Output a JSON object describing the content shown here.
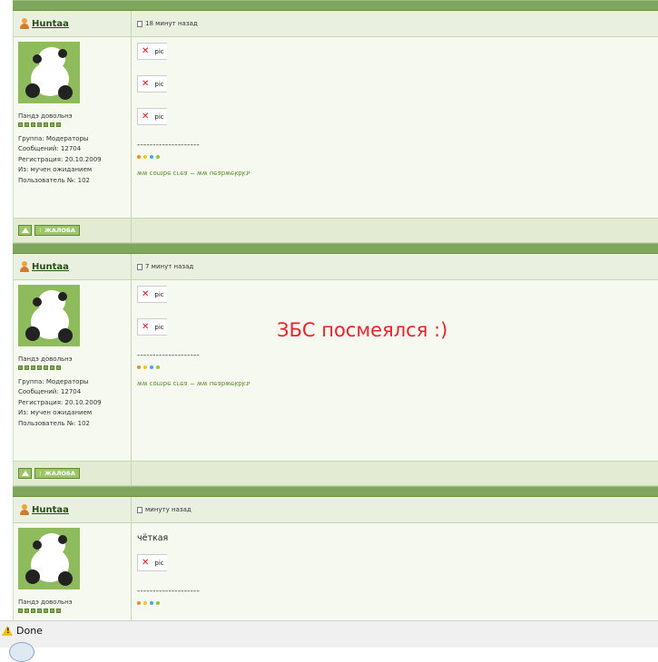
{
  "posts": [
    {
      "username": "Huntaa",
      "time": "18 минут назад",
      "rank_title": "Пандэ довольнэ",
      "group": "Группа: Модераторы",
      "messages": "Сообщений: 12704",
      "registered": "Регистрация: 20.10.2009",
      "from": "Из: мучен ожиданием",
      "user_no": "Пользователь №: 102",
      "text": "",
      "pics": [
        "pic",
        "pic",
        "pic"
      ],
      "divider": "--------------------",
      "signature": "ww combe cгеа ~ ww ueabwekbkъ",
      "report_label": "ЖАЛОБА"
    },
    {
      "username": "Huntaa",
      "time": "7 минут назад",
      "rank_title": "Пандэ довольнэ",
      "group": "Группа: Модераторы",
      "messages": "Сообщений: 12704",
      "registered": "Регистрация: 20.10.2009",
      "from": "Из: мучен ожиданием",
      "user_no": "Пользователь №: 102",
      "text": "",
      "pics": [
        "pic",
        "pic"
      ],
      "divider": "--------------------",
      "signature": "ww combe cгеа ~ ww ueabwekbkъ",
      "report_label": "ЖАЛОБА"
    },
    {
      "username": "Huntaa",
      "time": "минуту назад",
      "rank_title": "Пандэ довольнэ",
      "text": "чёткая",
      "pics": [
        "pic"
      ],
      "divider": "--------------------"
    }
  ],
  "overlay_comment": "ЗБС посмеялся :)",
  "signature_dot_colors": [
    "#f08c1f",
    "#f5c518",
    "#3fa9e0",
    "#8ec63f"
  ],
  "colors": {
    "separator": "#7fa65c",
    "overlay": "#e8242b"
  },
  "statusbar": {
    "text": "Done",
    "icon": "warning-icon"
  }
}
